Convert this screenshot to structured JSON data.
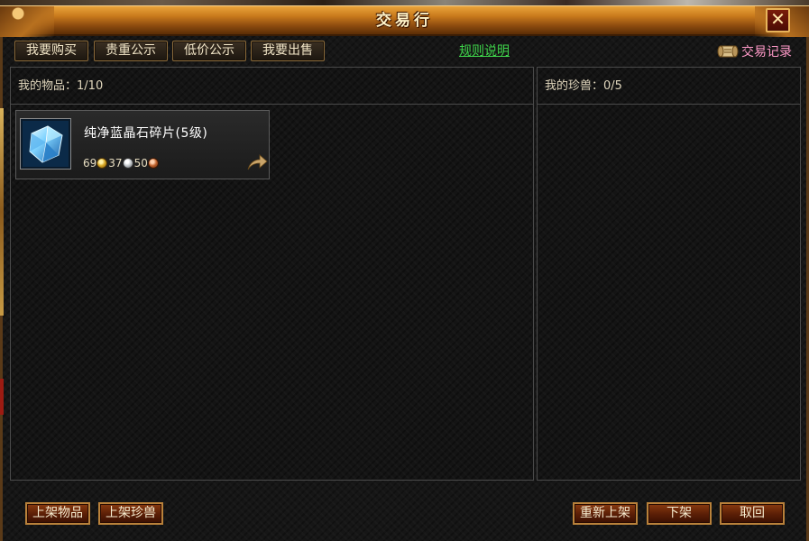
{
  "window": {
    "title": "交易行",
    "close_label": "✕"
  },
  "tabs": [
    {
      "label": "我要购买"
    },
    {
      "label": "贵重公示"
    },
    {
      "label": "低价公示"
    },
    {
      "label": "我要出售"
    }
  ],
  "rules_link": "规则说明",
  "trade_record": {
    "label": "交易记录",
    "icon": "scroll-icon"
  },
  "left_panel": {
    "header_label": "我的物品：",
    "count": "1/10"
  },
  "right_panel": {
    "header_label": "我的珍兽：",
    "count": "0/5"
  },
  "items": [
    {
      "name": "纯净蓝晶石碎片(5级)",
      "icon": "blue-crystal-icon",
      "price": {
        "gold": "69",
        "silver": "37",
        "copper": "50"
      }
    }
  ],
  "buttons": {
    "list_item": "上架物品",
    "list_pet": "上架珍兽",
    "relist": "重新上架",
    "delist": "下架",
    "retrieve": "取回"
  },
  "colors": {
    "title_gold": "#e9a43a",
    "rules_green": "#3fd54b",
    "trade_record_pink": "#ff9ac8"
  }
}
